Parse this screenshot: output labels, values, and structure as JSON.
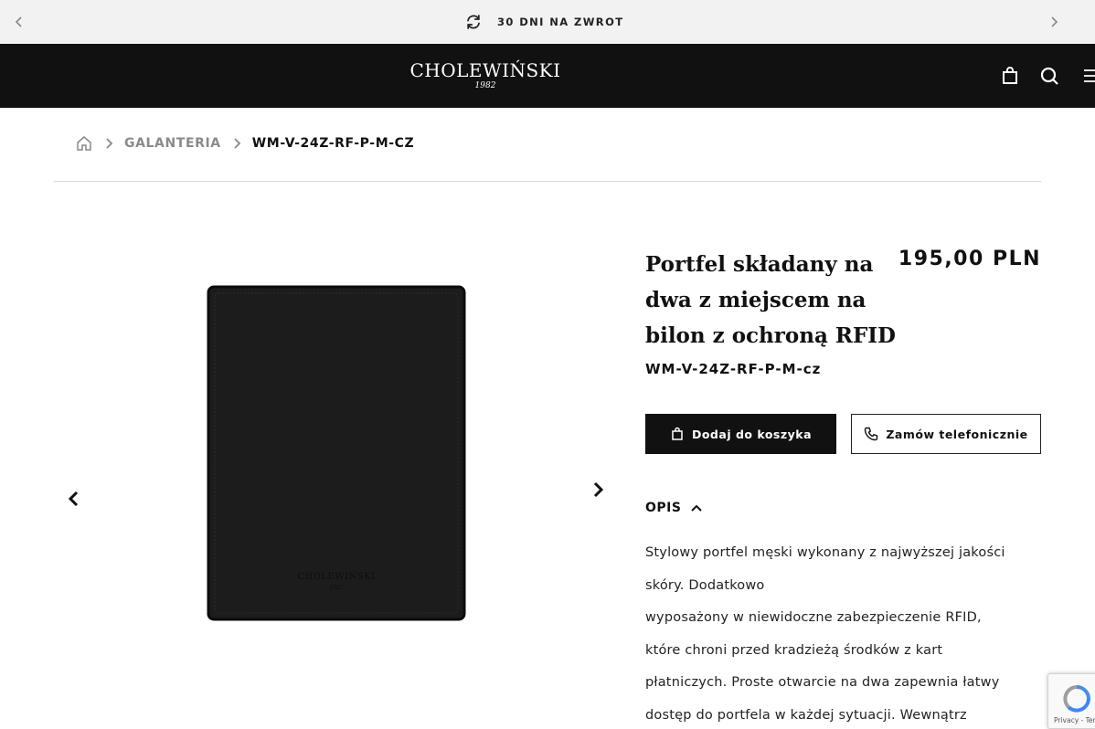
{
  "promo": {
    "text": "30 DNI NA ZWROT",
    "icon": "refresh-icon"
  },
  "header": {
    "logo_name": "CHOLEWIŃSKI",
    "logo_year": "1982",
    "icons": [
      "cart-icon",
      "search-icon",
      "menu-icon"
    ]
  },
  "breadcrumb": {
    "home_icon": "home-icon",
    "category": "GALANTERIA",
    "current": "WM-V-24Z-RF-P-M-CZ"
  },
  "product": {
    "title": "Portfel składany na dwa z miejscem na bilon z ochroną RFID",
    "price": "195,00 PLN",
    "sku": "WM-V-24Z-RF-P-M-cz",
    "image_embossing": "CHOLEWIŃSKI"
  },
  "actions": {
    "add_to_cart": "Dodaj do koszyka",
    "phone_order": "Zamów telefonicznie"
  },
  "description": {
    "heading": "OPIS",
    "lines": [
      "Stylowy portfel męski wykonany z najwyższej jakości",
      "skóry. Dodatkowo",
      "wyposażony w niewidoczne zabezpieczenie RFID,",
      "które chroni przed kradzieżą środków z kart",
      "płatniczych. Proste otwarcie na dwa zapewnia łatwy",
      "dostęp do portfela w każdej sytuacji. Wewnątrz"
    ]
  },
  "recaptcha": {
    "footer": "Privacy - Terms"
  },
  "colors": {
    "header_bg": "#111111",
    "promo_bg": "#f2f2f2",
    "accent": "#111111"
  }
}
